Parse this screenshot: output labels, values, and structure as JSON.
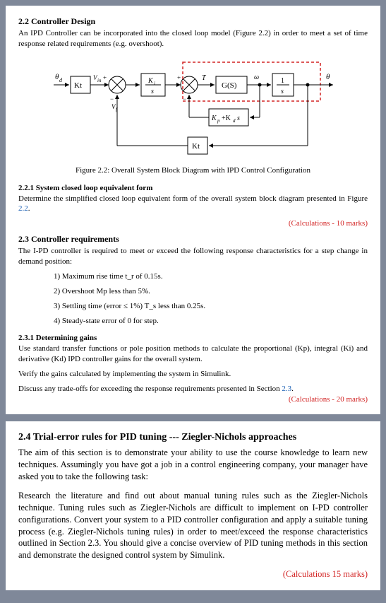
{
  "section22": {
    "title": "2.2 Controller Design",
    "intro": "An IPD Controller can be incorporated into the closed loop model (Figure 2.2) in order to meet a set of time response related requirements (e.g. overshoot).",
    "caption": "Figure 2.2: Overall System Block Diagram with IPD Control Configuration"
  },
  "diagram": {
    "theta_d": "θ_d",
    "kt1": "Kt",
    "sum1_top": "V_in+",
    "sum1_bot": "V_f",
    "ipd_num": "K_i",
    "ipd_den": "s",
    "sum2": "+",
    "tau": "T",
    "gs": "G(S)",
    "omega": "ω",
    "int_num": "1",
    "int_den": "s",
    "theta": "θ",
    "fb_inner": "K_p + K_d s",
    "kt2": "Kt"
  },
  "s221": {
    "title": "2.2.1 System closed loop equivalent form",
    "body_a": "Determine the simplified closed loop equivalent form of the overall system block diagram presented in Figure ",
    "link": "2.2",
    "period": ".",
    "marks": "(Calculations - 10 marks)"
  },
  "s23": {
    "title": "2.3 Controller requirements",
    "intro": "The I-PD controller is required to meet or exceed the following response characteristics for a step change in demand position:",
    "req1": "1) Maximum rise time t_r of 0.15s.",
    "req2": "2) Overshoot Mp less than 5%.",
    "req3": "3) Settling time (error ≤ 1%) T_s less than 0.25s.",
    "req4": "4) Steady-state error of 0 for step."
  },
  "s231": {
    "title": "2.3.1 Determining gains",
    "body1": "Use standard transfer functions or pole position methods to calculate the proportional (Kp), integral (Ki) and derivative (Kd) IPD controller gains for the overall system.",
    "body2": "Verify the gains calculated by implementing the system in Simulink.",
    "body3a": "Discuss any trade-offs for exceeding the response requirements presented in Section ",
    "link": "2.3",
    "period": ".",
    "marks": "(Calculations - 20 marks)"
  },
  "s24": {
    "title": "2.4 Trial-error rules for PID tuning --- Ziegler-Nichols approaches",
    "p1": "The aim of this section is to demonstrate your ability to use the course knowledge to learn new techniques. Assumingly you have got a job in a control engineering company, your manager have asked you to take the following task:",
    "p2": "Research the literature and find out about manual tuning rules such as the Ziegler-Nichols technique. Tuning rules such as Ziegler-Nichols are difficult to implement on I-PD controller configurations. Convert your system to a PID controller configuration and apply a suitable tuning process (e.g. Ziegler-Nichols tuning rules) in order to meet/exceed the response characteristics outlined in Section 2.3. You should give a concise overview of PID tuning methods in this section and demonstrate the designed control system by Simulink.",
    "marks": "(Calculations 15 marks)"
  }
}
